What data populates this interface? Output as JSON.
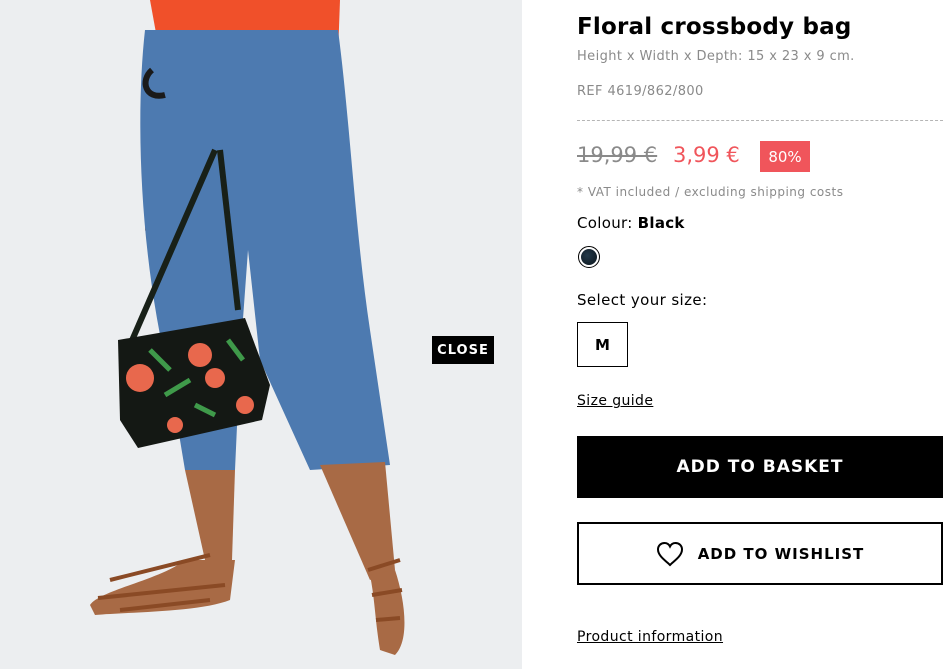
{
  "close_label": "CLOSE",
  "product": {
    "title": "Floral crossbody bag",
    "dimensions": "Height x Width x Depth: 15 x 23 x 9 cm.",
    "reference": "REF 4619/862/800"
  },
  "price": {
    "original": "19,99 €",
    "current": "3,99 €",
    "discount": "80%",
    "vat_note": "* VAT included / excluding shipping costs",
    "sale_color": "#f0555b"
  },
  "colour": {
    "label": "Colour:",
    "value": "Black",
    "swatch_color": "#12202a"
  },
  "size": {
    "label": "Select your size:",
    "options": [
      "M"
    ],
    "size_guide_label": "Size guide"
  },
  "actions": {
    "add_to_basket": "ADD TO BASKET",
    "add_to_wishlist": "ADD TO WISHLIST",
    "wishlist_icon": "heart-icon"
  },
  "product_information_label": "Product information"
}
